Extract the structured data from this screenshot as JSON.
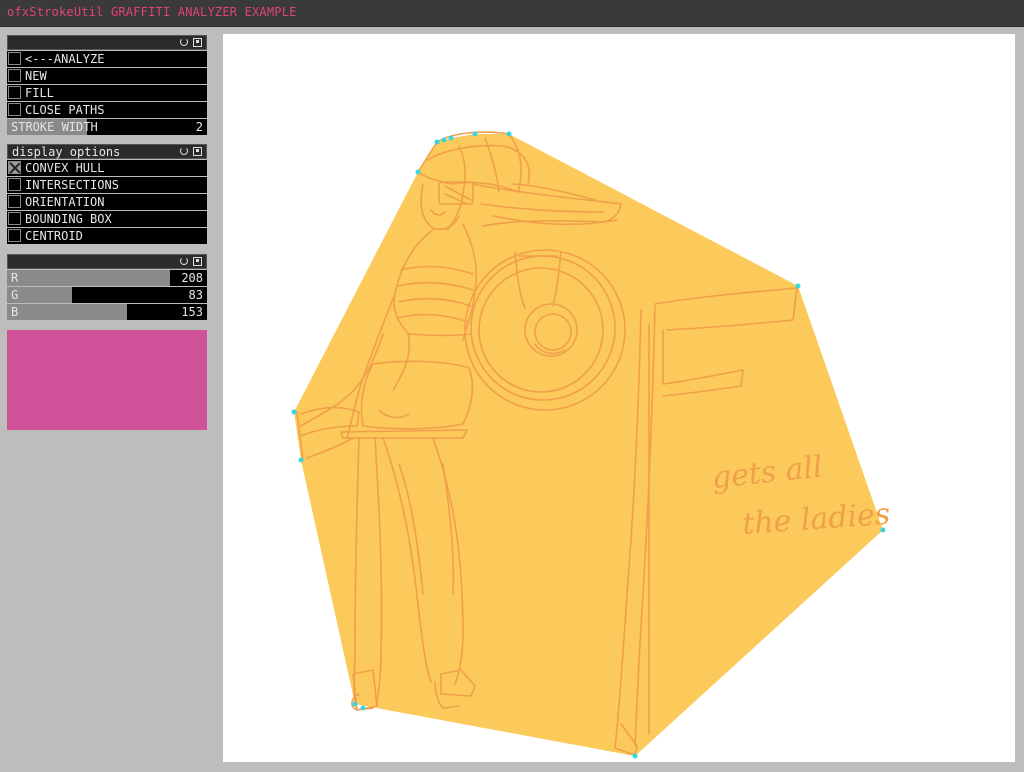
{
  "window": {
    "title": "ofxStrokeUtil GRAFFITI ANALYZER EXAMPLE",
    "title_color": "#e0437a"
  },
  "panel1": {
    "buttons": [
      {
        "label": "<---ANALYZE",
        "checked": false
      },
      {
        "label": "NEW",
        "checked": false
      },
      {
        "label": "FILL",
        "checked": false
      },
      {
        "label": "CLOSE PATHS",
        "checked": false
      }
    ],
    "stroke_width": {
      "label": "STROKE WIDTH",
      "value": "2",
      "fraction": 0.4
    }
  },
  "panel2": {
    "title": "display options",
    "options": [
      {
        "label": "CONVEX HULL",
        "checked": true
      },
      {
        "label": "INTERSECTIONS",
        "checked": false
      },
      {
        "label": "ORIENTATION",
        "checked": false
      },
      {
        "label": "BOUNDING BOX",
        "checked": false
      },
      {
        "label": "CENTROID",
        "checked": false
      }
    ]
  },
  "panel3": {
    "sliders": [
      {
        "label": "R",
        "value": "208",
        "fraction": 0.8157
      },
      {
        "label": "G",
        "value": "83",
        "fraction": 0.3255
      },
      {
        "label": "B",
        "value": "153",
        "fraction": 0.6
      }
    ]
  },
  "swatch": {
    "color": "#d05399"
  },
  "canvas": {
    "hull_fill": "#fcc95b",
    "stroke_color": "#f0a04a",
    "vertex_color": "#36d6e0",
    "handwriting": [
      "gets all",
      "the ladies"
    ]
  }
}
